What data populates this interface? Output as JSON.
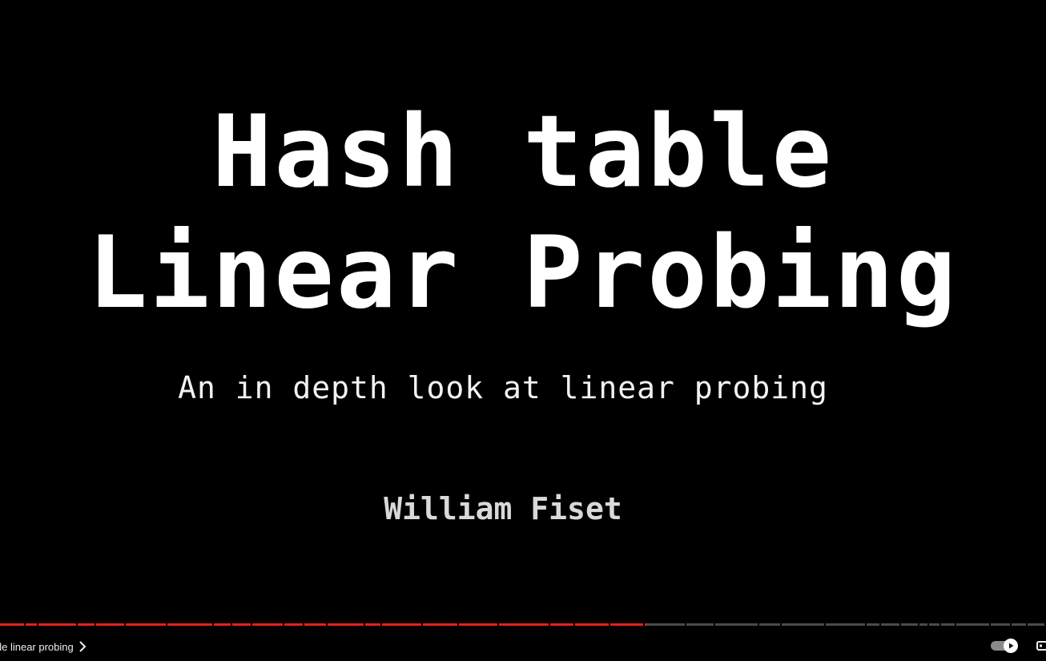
{
  "slide": {
    "title_line_1": "Hash table",
    "title_line_2": "Linear Probing",
    "subtitle": "An in depth look at linear probing",
    "author": "William Fiset"
  },
  "player": {
    "chapter_title": "ble linear probing",
    "progress_fraction": 0.618,
    "played_color": "#e62117",
    "unplayed_color": "#4a4a4a",
    "gap_color": "#000000"
  },
  "icons": {
    "chapter_arrow": "chevron-right-icon",
    "autoplay": "autoplay-toggle-icon",
    "subtitles": "subtitles-icon"
  }
}
